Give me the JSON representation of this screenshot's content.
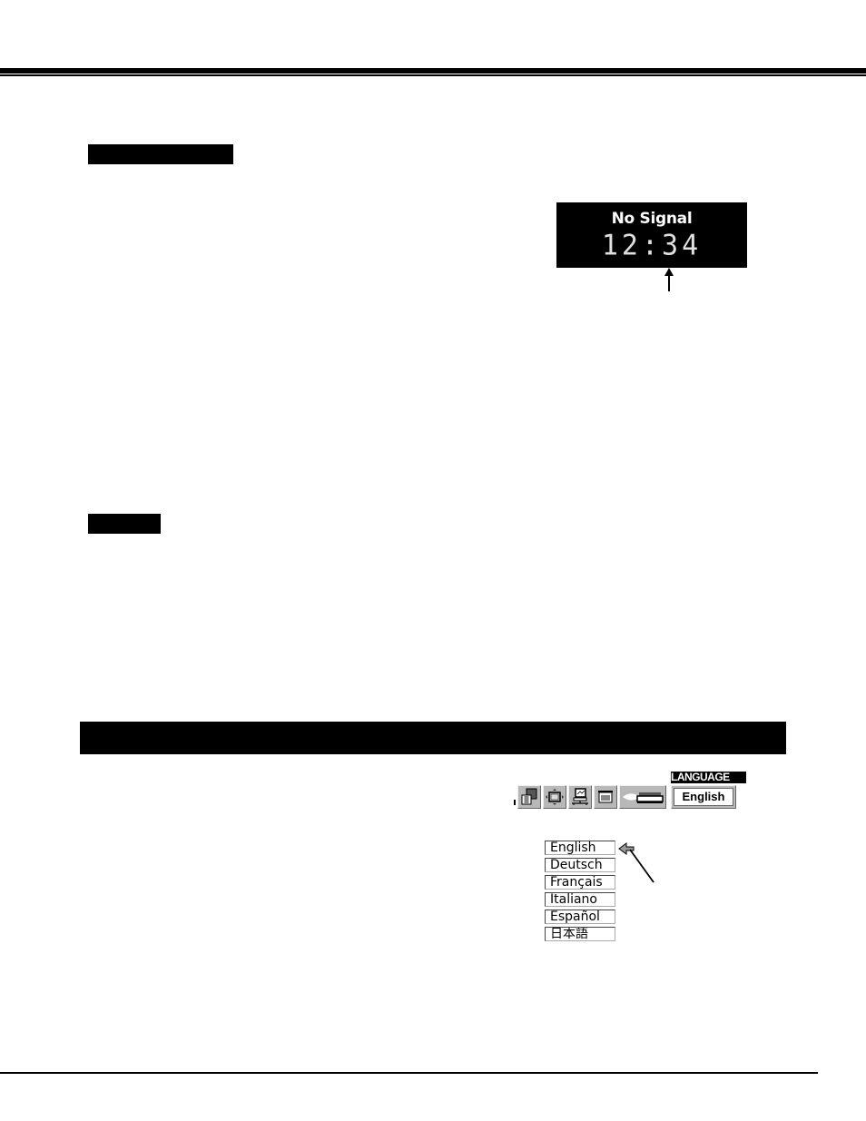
{
  "page": {
    "header_rule": "double-rule",
    "section_labels": [
      "",
      ""
    ],
    "section_bar_title": ""
  },
  "signal_display": {
    "title": "No Signal",
    "time": "12:34"
  },
  "language_menu": {
    "header": "LANGUAGE",
    "current_value": "English",
    "toolbar_icons": [
      "image-adjust-icon",
      "screen-position-icon",
      "pc-adjust-icon",
      "screen-icon",
      "lamp-icon"
    ],
    "options": [
      "English",
      "Deutsch",
      "Français",
      "Italiano",
      "Español",
      "日本語"
    ],
    "selected_index": 0
  }
}
